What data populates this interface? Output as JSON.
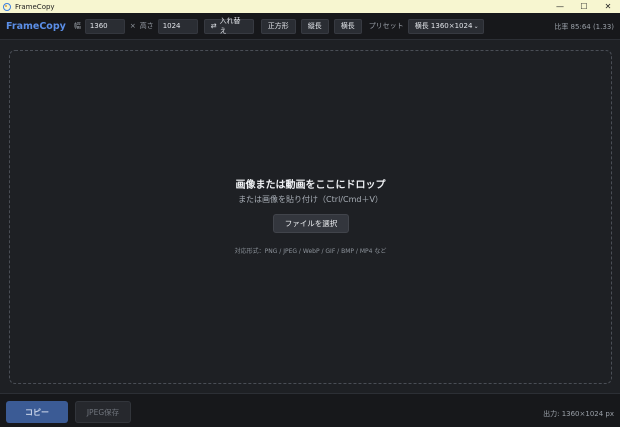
{
  "window": {
    "title": "FrameCopy",
    "controls": {
      "minimize": "—",
      "maximize": "☐",
      "close": "✕"
    }
  },
  "toolbar": {
    "brand": "FrameCopy",
    "width_label": "幅",
    "width_value": "1360",
    "times": "×",
    "height_label": "高さ",
    "height_value": "1024",
    "swap_icon": "⇄",
    "swap_label": "入れ替え",
    "square_label": "正方形",
    "portrait_label": "縦長",
    "landscape_label": "横長",
    "preset_label": "プリセット",
    "preset_value": "横長 1360×1024",
    "preset_chevron": "⌄",
    "ratio": "比率 85:64 (1.33)"
  },
  "dropzone": {
    "title": "画像または動画をここにドロップ",
    "subtitle": "または画像を貼り付け（Ctrl/Cmd＋V）",
    "choose_button": "ファイルを選択",
    "formats": "対応形式：PNG / JPEG / WebP / GIF / BMP / MP4 など"
  },
  "bottom": {
    "copy_button": "コピー",
    "jpeg_button": "JPEG保存",
    "output": "出力: 1360×1024 px"
  },
  "colors": {
    "accent": "#5b8fe8",
    "primary_button": "#3b5b95",
    "background": "#1e2024",
    "titlebar": "#f7f6d0"
  }
}
